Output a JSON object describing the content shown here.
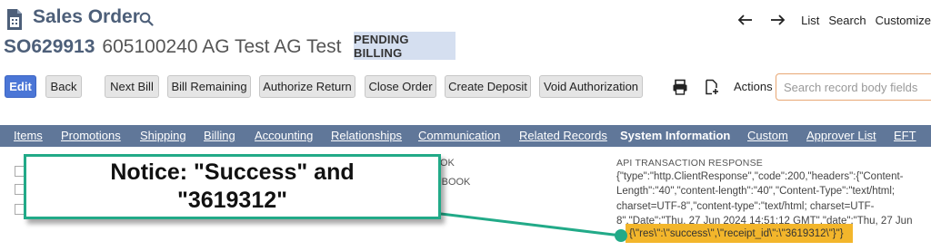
{
  "header": {
    "record_type": "Sales Order",
    "nav_links": [
      "List",
      "Search",
      "Customize"
    ],
    "tranid": "SO629913",
    "entity": "605100240 AG Test AG Test",
    "status": "PENDING BILLING"
  },
  "buttons": {
    "edit": "Edit",
    "back": "Back",
    "next_bill": "Next Bill",
    "bill_remaining": "Bill Remaining",
    "authorize_return": "Authorize Return",
    "close_order": "Close Order",
    "create_deposit": "Create Deposit",
    "void_authorization": "Void Authorization",
    "actions": "Actions",
    "search_placeholder": "Search record body fields"
  },
  "subtabs": [
    "Items",
    "Promotions",
    "Shipping",
    "Billing",
    "Accounting",
    "Relationships",
    "Communication",
    "Related Records",
    "System Information",
    "Custom",
    "Approver List",
    "EFT"
  ],
  "active_subtab": "System Information",
  "partial_labels": [
    "OK",
    "G BOOK"
  ],
  "api": {
    "label": "API TRANSACTION RESPONSE",
    "lines": [
      "{\"type\":\"http.ClientResponse\",\"code\":200,\"headers\":{\"Content-",
      "Length\":\"40\",\"content-length\":\"40\",\"Content-Type\":\"text/html;",
      "charset=UTF-8\",\"content-type\":\"text/html; charset=UTF-",
      "8\",\"Date\":\"Thu, 27 Jun 2024 14:51:12 GMT\",\"date\":\"Thu, 27 Jun"
    ],
    "highlight": "{\\\"res\\\":\\\"success\\\",\\\"receipt_id\\\":\\\"3619312\\\"}\"}"
  },
  "annotation": {
    "line1": "Notice: \"Success\" and",
    "line2": "\"3619312\""
  },
  "colors": {
    "brand": "#4d5f79",
    "subtab_bar": "#607799",
    "primary_button": "#4b76d6",
    "status_badge": "#d5dff0",
    "highlight": "#f3b62b",
    "annotation_border": "#22aa88"
  }
}
